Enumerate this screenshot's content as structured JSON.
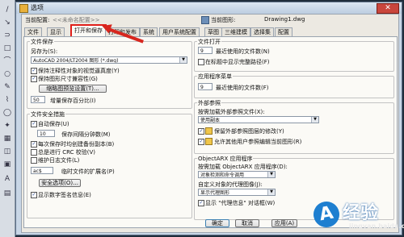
{
  "window": {
    "title": "选项",
    "close_glyph": "✕"
  },
  "header": {
    "profile_label": "当前配置:",
    "profile_value": "<<未命名配置>>",
    "drawing_label": "当前图形:",
    "drawing_value": "Drawing1.dwg"
  },
  "tabs": [
    "文件",
    "显示",
    "打开和保存",
    "打印和发布",
    "系统",
    "用户系统配置",
    "草图",
    "三维建模",
    "选择集",
    "配置"
  ],
  "active_tab": "打开和保存",
  "file_save": {
    "title": "文件保存",
    "save_as_label": "另存为(S):",
    "save_as_value": "AutoCAD 2004/LT2004 图形 (*.dwg)",
    "maintain_visual_label": "保持注释性对象的视觉逼真度(Y)",
    "maintain_drawing_size_label": "保持图形尺寸兼容性(G)",
    "thumbnail_button": "缩略图预览设置(T)...",
    "incremental_value": "50",
    "incremental_label": "增量保存百分比(I)"
  },
  "file_safety": {
    "title": "文件安全措施",
    "autosave_label": "自动保存(U)",
    "autosave_minutes_value": "10",
    "autosave_minutes_label": "保存间隔分钟数(M)",
    "backup_label": "每次保存时均创建备份副本(B)",
    "crc_label": "总是进行 CRC 校验(V)",
    "log_label": "维护日志文件(L)",
    "temp_ext_value": "ac$",
    "temp_ext_label": "临时文件的扩展名(P)",
    "security_button": "安全选项(O)...",
    "digital_sig_label": "显示数字签名信息(E)"
  },
  "file_open": {
    "title": "文件打开",
    "recent_files_value": "9",
    "recent_files_label": "最近使用的文件数(N)",
    "full_path_label": "在标题中显示完整路径(F)"
  },
  "app_menu": {
    "title": "应用程序菜单",
    "recent_files_value": "9",
    "recent_files_label": "最近使用的文件数(F)"
  },
  "xref": {
    "title": "外部参照",
    "demand_load_label": "按需加载外部参照文件(X):",
    "demand_load_value": "使用副本",
    "retain_changes_label": "保留外部参照图层的修改(Y)",
    "allow_edit_label": "允许其他用户参照编辑当前图形(R)"
  },
  "objectarx": {
    "title": "ObjectARX 应用程序",
    "load_label": "按需加载 ObjectARX 应用程序(D):",
    "load_value": "对象检测和命令调用",
    "proxy_label": "自定义对象的代理图像(J):",
    "proxy_value": "显示代理图形",
    "proxy_info_label": "显示 \"代理信息\" 对话框(W)"
  },
  "buttons": {
    "ok": "确定",
    "cancel": "取消",
    "apply": "应用(A)"
  },
  "watermark": {
    "logo_letter": "A",
    "text": "经验",
    "site": "jingyan.baidu.com"
  },
  "left_toolbar": [
    "/",
    "↘",
    "⊃",
    "□",
    "⌒",
    "○",
    "✎",
    "⌇",
    "◯",
    "✦",
    "▦",
    "◫",
    "▣",
    "A",
    "▤"
  ]
}
